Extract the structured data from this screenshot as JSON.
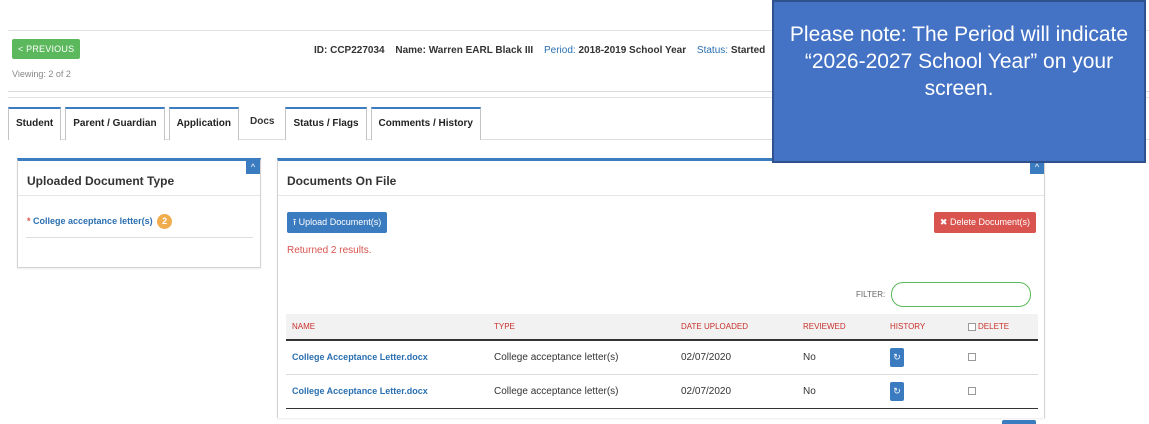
{
  "header": {
    "previous_label": "< PREVIOUS",
    "viewing": "Viewing: 2 of 2",
    "id_text": "ID: CCP227034",
    "name_text": "Name: Warren EARL Black III",
    "period_label": "Period:",
    "period_value": "2018-2019 School Year",
    "status_label": "Status:",
    "status_value": "Started"
  },
  "tabs": [
    {
      "label": "Student"
    },
    {
      "label": "Parent / Guardian"
    },
    {
      "label": "Application"
    },
    {
      "label": "Docs",
      "active": true
    },
    {
      "label": "Status / Flags"
    },
    {
      "label": "Comments / History"
    }
  ],
  "left_panel": {
    "title": "Uploaded Document Type",
    "item_star": "*",
    "item_label": "College acceptance letter(s)",
    "item_count": "2"
  },
  "right_panel": {
    "title": "Documents On File",
    "upload_label": "Upload Document(s)",
    "delete_label": "Delete Document(s)",
    "results_text": "Returned 2 results.",
    "filter_label": "FILTER:",
    "filter_value": "",
    "columns": [
      "NAME",
      "TYPE",
      "DATE UPLOADED",
      "REVIEWED",
      "HISTORY",
      "DELETE"
    ],
    "rows": [
      {
        "name": "College Acceptance Letter.docx",
        "type": "College acceptance letter(s)",
        "date": "02/07/2020",
        "reviewed": "No"
      },
      {
        "name": "College Acceptance Letter.docx",
        "type": "College acceptance letter(s)",
        "date": "02/07/2020",
        "reviewed": "No"
      }
    ]
  },
  "note": {
    "text": "Please note: The Period will indicate “2026-2027 School Year” on your screen."
  },
  "colors": {
    "primary": "#3b7bbf",
    "success": "#5cb85c",
    "danger": "#d9534f",
    "badge": "#f0ad4e",
    "note_bg": "#4472c4"
  },
  "icons": {
    "previous": "chevron-left-icon",
    "upload": "upload-icon",
    "delete": "close-icon",
    "history": "history-icon",
    "collapse": "chevron-up-icon"
  }
}
